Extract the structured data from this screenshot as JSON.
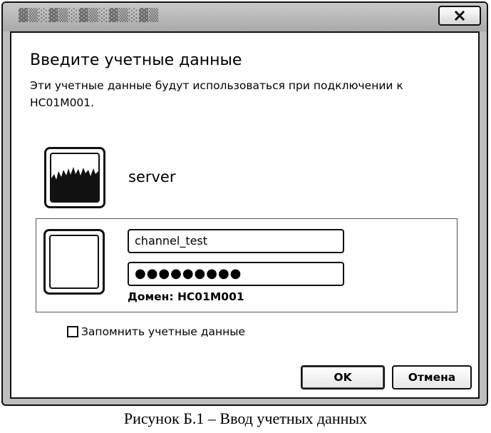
{
  "window": {
    "close_glyph": "✕"
  },
  "dialog": {
    "heading": "Введите учетные данные",
    "description": "Эти учетные данные будут использоваться при подключении к HC01M001."
  },
  "server": {
    "icon": "server-image-icon",
    "name": "server"
  },
  "credentials": {
    "user_icon": "user-tile-icon",
    "username_value": "channel_test",
    "password_value": "●●●●●●●●●",
    "domain_text": "Домен: HC01M001"
  },
  "remember": {
    "checked": false,
    "label": "Запомнить учетные данные"
  },
  "buttons": {
    "ok_label": "OK",
    "cancel_label": "Отмена"
  },
  "caption": {
    "text": "Рисунок Б.1 – Ввод учетных данных"
  }
}
